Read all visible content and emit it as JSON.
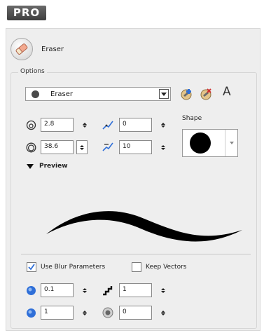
{
  "badge": {
    "label": "PRO"
  },
  "tool": {
    "title": "Eraser",
    "icon": "eraser-icon"
  },
  "options": {
    "group_label": "Options",
    "preset": {
      "name": "Eraser",
      "icon": "round-brush-dot-icon"
    },
    "preset_buttons": [
      "new-preset-icon",
      "delete-preset-icon"
    ],
    "rename_glyph": "A",
    "min_size": "2.8",
    "max_size": "38.6",
    "smoothness": "0",
    "thickness_stability": "10",
    "shape": {
      "label": "Shape",
      "selected": "round-tip-icon"
    },
    "preview": {
      "label": "Preview"
    },
    "use_blur_parameters": {
      "label": "Use Blur Parameters",
      "checked": true
    },
    "keep_vectors": {
      "label": "Keep Vectors",
      "checked": false
    },
    "blur": "0.1",
    "vector_smoothness": "1",
    "blur_radius": "1",
    "opacity_setting": "0"
  },
  "colors": {
    "accent": "#2f6fd8",
    "panel_bg": "#eeeeee",
    "stroke": "#000000"
  }
}
